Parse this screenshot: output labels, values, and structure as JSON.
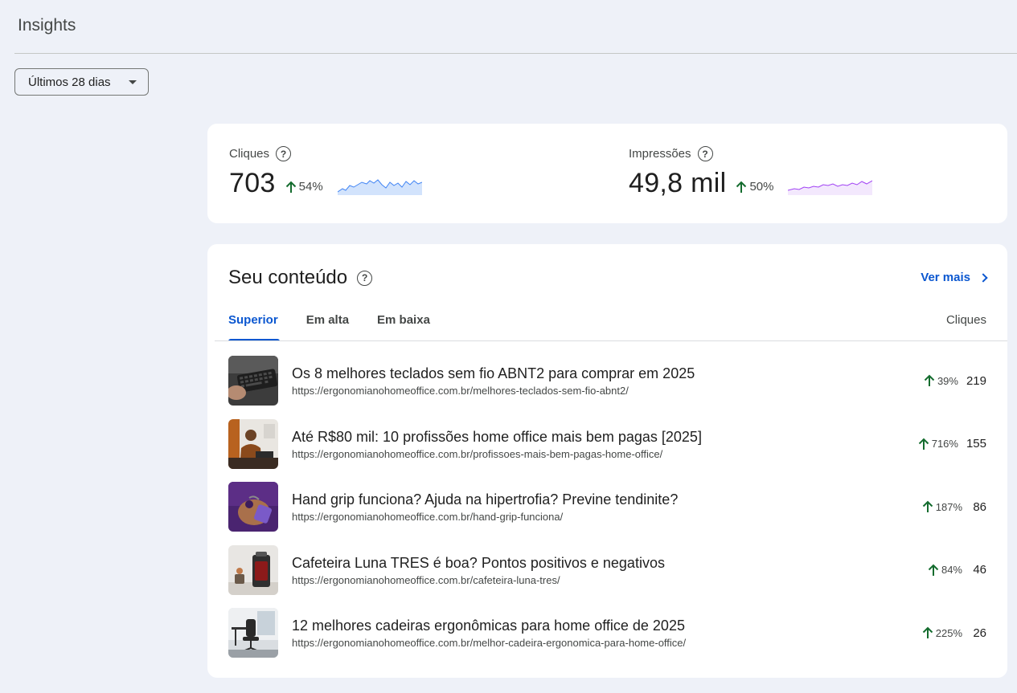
{
  "header": {
    "title": "Insights",
    "date_range": "Últimos 28 dias"
  },
  "metrics": {
    "clicks": {
      "label": "Cliques",
      "value": "703",
      "change": "54%",
      "color": "#4285f4"
    },
    "impressions": {
      "label": "Impressões",
      "value": "49,8 mil",
      "change": "50%",
      "color": "#a142f4"
    }
  },
  "content": {
    "title": "Seu conteúdo",
    "see_more": "Ver mais",
    "tabs": [
      "Superior",
      "Em alta",
      "Em baixa"
    ],
    "active_tab": "Superior",
    "column_header": "Cliques",
    "rows": [
      {
        "title": "Os 8 melhores teclados sem fio ABNT2 para comprar em 2025",
        "url": "https://ergonomianohomeoffice.com.br/melhores-teclados-sem-fio-abnt2/",
        "change": "39%",
        "clicks": "219"
      },
      {
        "title": "Até R$80 mil: 10 profissões home office mais bem pagas [2025]",
        "url": "https://ergonomianohomeoffice.com.br/profissoes-mais-bem-pagas-home-office/",
        "change": "716%",
        "clicks": "155"
      },
      {
        "title": "Hand grip funciona? Ajuda na hipertrofia? Previne tendinite?",
        "url": "https://ergonomianohomeoffice.com.br/hand-grip-funciona/",
        "change": "187%",
        "clicks": "86"
      },
      {
        "title": "Cafeteira Luna TRES é boa? Pontos positivos e negativos",
        "url": "https://ergonomianohomeoffice.com.br/cafeteira-luna-tres/",
        "change": "84%",
        "clicks": "46"
      },
      {
        "title": "12 melhores cadeiras ergonômicas para home office de 2025",
        "url": "https://ergonomianohomeoffice.com.br/melhor-cadeira-ergonomica-para-home-office/",
        "change": "225%",
        "clicks": "26"
      }
    ]
  },
  "colors": {
    "accent": "#0b57d0",
    "trend_up": "#146c2e",
    "background": "#eef1f8"
  }
}
